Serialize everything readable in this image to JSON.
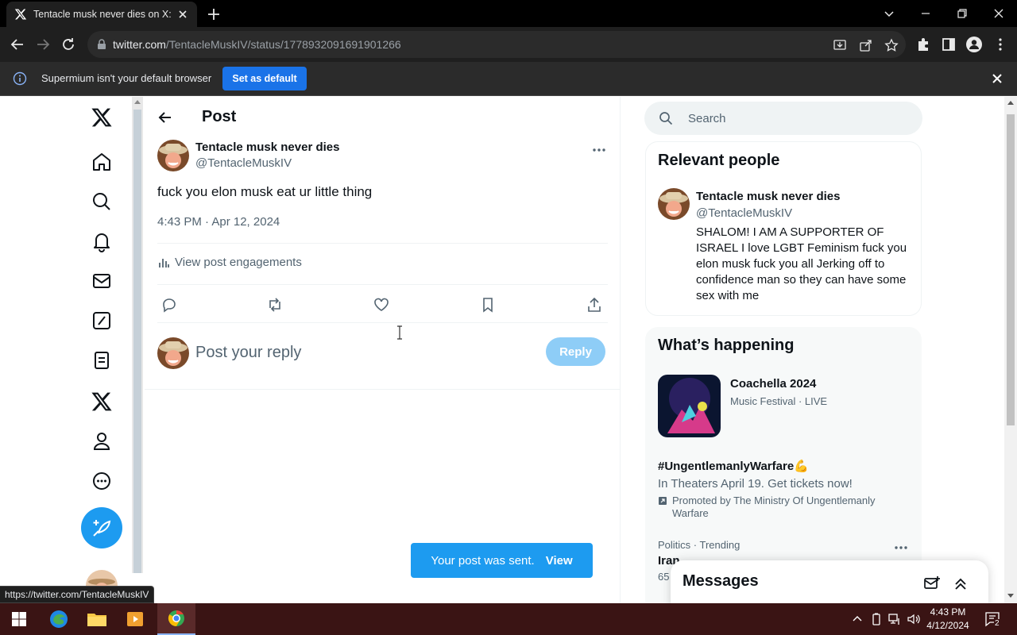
{
  "browser": {
    "tab_title": "Tentacle musk never dies on X: \"",
    "url_host": "twitter.com",
    "url_path": "/TentacleMuskIV/status/1778932091691901266",
    "infobar_text": "Supermium isn't your default browser",
    "set_default_label": "Set as default",
    "status_url": "https://twitter.com/TentacleMuskIV"
  },
  "post": {
    "header_title": "Post",
    "author_name": "Tentacle musk never dies",
    "author_handle": "@TentacleMuskIV",
    "text": "fuck you elon musk eat ur little thing",
    "timestamp": "4:43 PM · Apr 12, 2024",
    "engagements_label": "View post engagements",
    "reply_placeholder": "Post your reply",
    "reply_button": "Reply"
  },
  "toast": {
    "message": "Your post was sent.",
    "action": "View"
  },
  "search": {
    "placeholder": "Search"
  },
  "relevant_people": {
    "title": "Relevant people",
    "name": "Tentacle musk never dies",
    "handle": "@TentacleMuskIV",
    "bio": "SHALOM! I AM A SUPPORTER OF ISRAEL I love LGBT Feminism fuck you elon musk fuck you all Jerking off to confidence man so they can have some sex with me"
  },
  "whats_happening": {
    "title": "What’s happening",
    "trend1_name": "Coachella 2024",
    "trend1_meta": "Music Festival · LIVE",
    "promo_tag": "#UngentlemanlyWarfare💪",
    "promo_line": "In Theaters April 19. Get tickets now!",
    "promo_by": "Promoted by The Ministry Of Ungentlemanly Warfare",
    "trend2_context": "Politics · Trending",
    "trend2_name": "Iran",
    "trend2_count": "65"
  },
  "messages": {
    "title": "Messages"
  },
  "taskbar": {
    "time": "4:43 PM",
    "date": "4/12/2024",
    "notification_count": "2"
  },
  "colors": {
    "accent": "#1d9bf0",
    "taskbar": "#3a1414",
    "chrome_dark": "#1f1f1f"
  }
}
